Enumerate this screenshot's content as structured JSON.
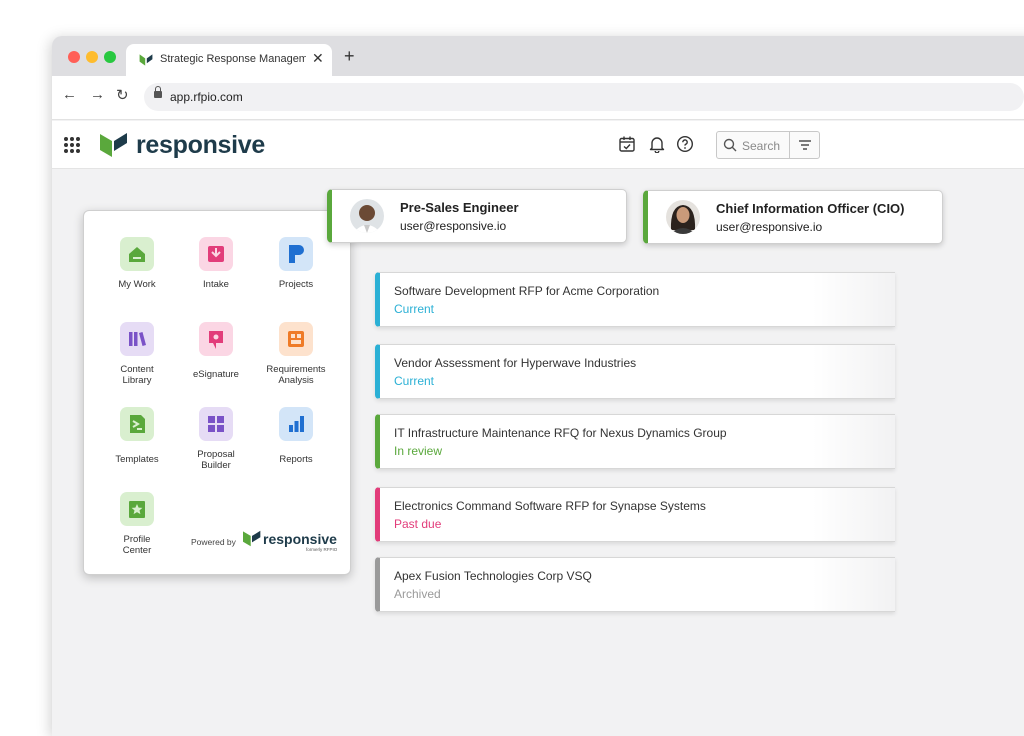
{
  "browser": {
    "tab_title": "Strategic Response Management",
    "close_glyph": "✕",
    "new_tab_glyph": "+",
    "back_glyph": "←",
    "forward_glyph": "→",
    "reload_glyph": "↻",
    "url": "app.rfpio.com"
  },
  "header": {
    "brand": "responsive",
    "search_placeholder": "Search",
    "icons": [
      "calendar-icon",
      "bell-icon",
      "help-icon",
      "filter-icon"
    ]
  },
  "launcher": {
    "apps": [
      {
        "label": "My Work",
        "icon": "home-icon",
        "color": "#5aa83c",
        "bg": "#d9efcf"
      },
      {
        "label": "Intake",
        "icon": "download-icon",
        "color": "#e23c7a",
        "bg": "#fbd6e4"
      },
      {
        "label": "Projects",
        "icon": "projects-icon",
        "color": "#1f6fd1",
        "bg": "#d3e5f8"
      },
      {
        "label": "Content\nLibrary",
        "icon": "library-icon",
        "color": "#7a52c7",
        "bg": "#e6dcf5"
      },
      {
        "label": "eSignature",
        "icon": "signature-icon",
        "color": "#e23c7a",
        "bg": "#fbd6e4"
      },
      {
        "label": "Requirements\nAnalysis",
        "icon": "analysis-icon",
        "color": "#ef7b27",
        "bg": "#fde2cd"
      },
      {
        "label": "Templates",
        "icon": "templates-icon",
        "color": "#5aa83c",
        "bg": "#d9efcf"
      },
      {
        "label": "Proposal\nBuilder",
        "icon": "builder-icon",
        "color": "#7a52c7",
        "bg": "#e6dcf5"
      },
      {
        "label": "Reports",
        "icon": "reports-icon",
        "color": "#1f6fd1",
        "bg": "#d3e5f8"
      },
      {
        "label": "Profile\nCenter",
        "icon": "profile-star-icon",
        "color": "#5aa83c",
        "bg": "#d9efcf"
      }
    ],
    "powered_by": "Powered by",
    "powered_brand": "responsive",
    "powered_sub": "formerly RFPIO"
  },
  "users": [
    {
      "role": "Pre-Sales Engineer",
      "email": "user@responsive.io"
    },
    {
      "role": "Chief Information Officer (CIO)",
      "email": "user@responsive.io"
    }
  ],
  "projects": [
    {
      "title": "Software Development RFP for Acme Corporation",
      "status": "Current",
      "color": "#2bb0d5"
    },
    {
      "title": "Vendor Assessment for Hyperwave Industries",
      "status": "Current",
      "color": "#2bb0d5"
    },
    {
      "title": "IT Infrastructure Maintenance RFQ for Nexus Dynamics Group",
      "status": "In review",
      "color": "#5aa83c"
    },
    {
      "title": "Electronics Command Software RFP for Synapse Systems",
      "status": "Past due",
      "color": "#e23c7a"
    },
    {
      "title": "Apex Fusion Technologies Corp VSQ",
      "status": "Archived",
      "color": "#9a9a9a"
    }
  ],
  "colors": {
    "brand_green": "#5aa83c",
    "brand_navy": "#1e3b4a"
  }
}
